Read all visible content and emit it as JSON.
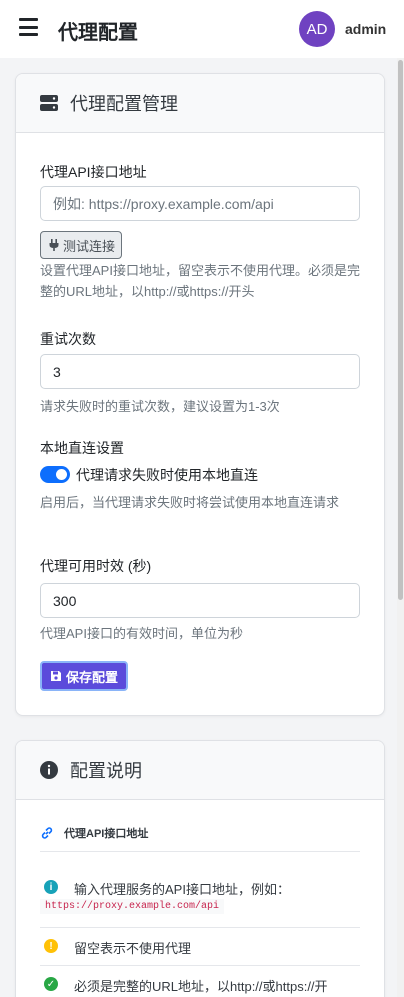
{
  "header": {
    "title": "代理配置",
    "avatar_initials": "AD",
    "username": "admin"
  },
  "config_card": {
    "title": "代理配置管理",
    "api_url": {
      "label": "代理API接口地址",
      "placeholder": "例如: https://proxy.example.com/api",
      "value": "",
      "test_button": "测试连接",
      "help": "设置代理API接口地址，留空表示不使用代理。必须是完整的URL地址，以http://或https://开头"
    },
    "retry": {
      "label": "重试次数",
      "value": "3",
      "help": "请求失败时的重试次数，建议设置为1-3次"
    },
    "local_direct": {
      "label": "本地直连设置",
      "switch_label": "代理请求失败时使用本地直连",
      "enabled": true,
      "help": "启用后，当代理请求失败时将尝试使用本地直连请求"
    },
    "ttl": {
      "label": "代理可用时效 (秒)",
      "value": "300",
      "help": "代理API接口的有效时间，单位为秒"
    },
    "save_button": "保存配置"
  },
  "info_card": {
    "title": "配置说明",
    "section_title": "代理API接口地址",
    "items": [
      {
        "icon": "info-icon",
        "text": "输入代理服务的API接口地址，例如：",
        "code": "https://proxy.example.com/api"
      },
      {
        "icon": "warning-icon",
        "text": "留空表示不使用代理"
      },
      {
        "icon": "check-icon",
        "text": "必须是完整的URL地址，以http://或https://开"
      }
    ]
  },
  "colors": {
    "primary": "#0d6efd",
    "avatar": "#6f42c1",
    "save": "#5b4bdb",
    "info": "#17a2b8",
    "warning": "#ffc107",
    "success": "#28a745"
  }
}
